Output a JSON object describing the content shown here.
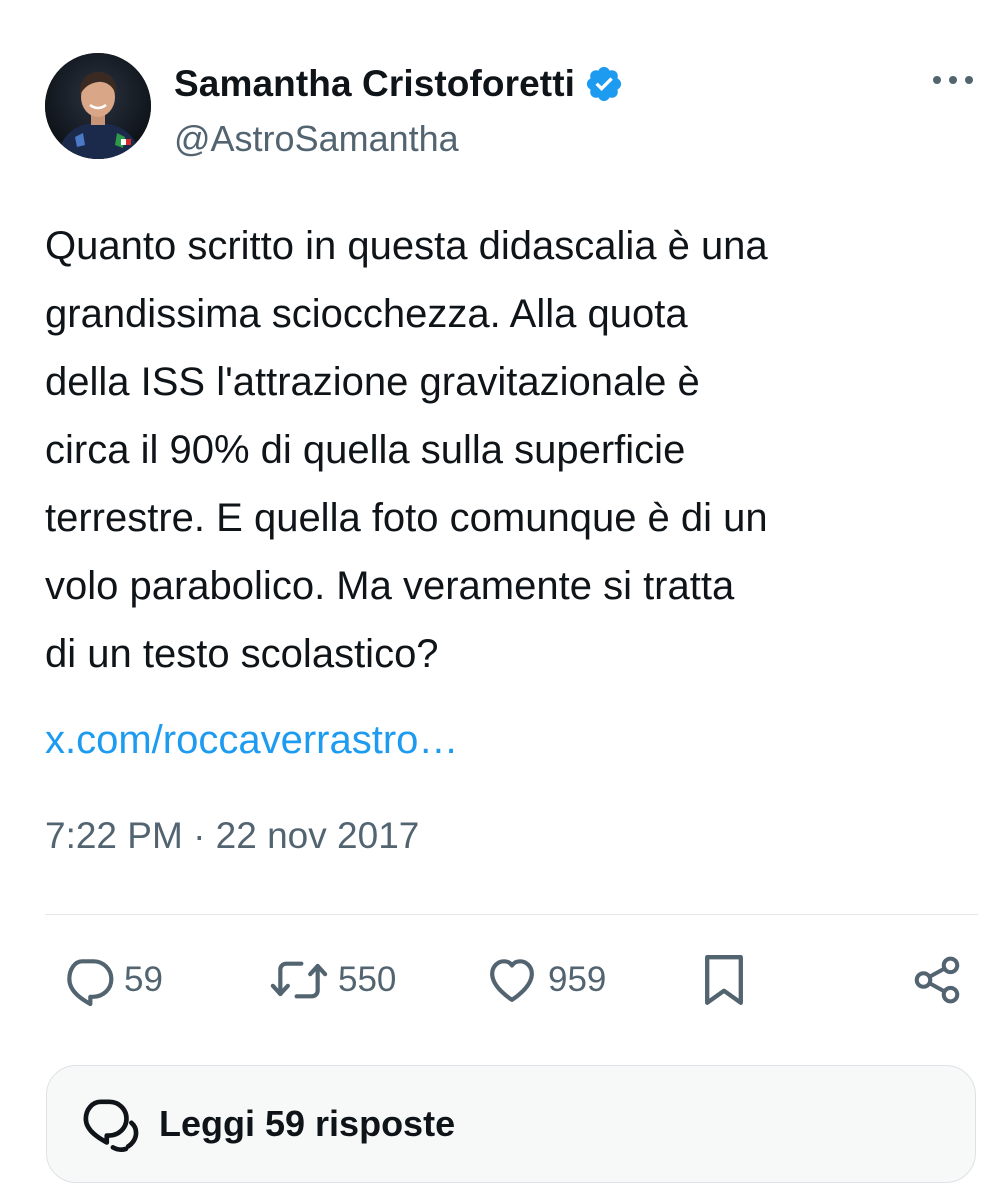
{
  "author": {
    "display_name": "Samantha Cristoforetti",
    "handle": "@AstroSamantha",
    "verified": true,
    "verified_color": "#1d9bf0"
  },
  "tweet": {
    "text": "Quanto scritto in questa didascalia è una\ngrandissima sciocchezza. Alla quota\ndella ISS l'attrazione gravitazionale è\ncirca il 90% di quella sulla superficie\nterrestre. E quella foto comunque è di un\nvolo parabolico. Ma veramente si tratta\ndi un testo scolastico?",
    "link_text": "x.com/roccaverrastro…",
    "timestamp": "7:22 PM · 22 nov 2017"
  },
  "actions": {
    "replies": "59",
    "retweets": "550",
    "likes": "959"
  },
  "replies_button": {
    "label": "Leggi 59 risposte"
  },
  "icons": {
    "more": "more-dots-icon",
    "reply": "reply-bubble-icon",
    "retweet": "retweet-icon",
    "like": "heart-icon",
    "bookmark": "bookmark-icon",
    "share": "share-icon",
    "replies": "conversation-icon"
  },
  "colors": {
    "text": "#0f1419",
    "secondary": "#536471",
    "link": "#1d9bf0"
  }
}
